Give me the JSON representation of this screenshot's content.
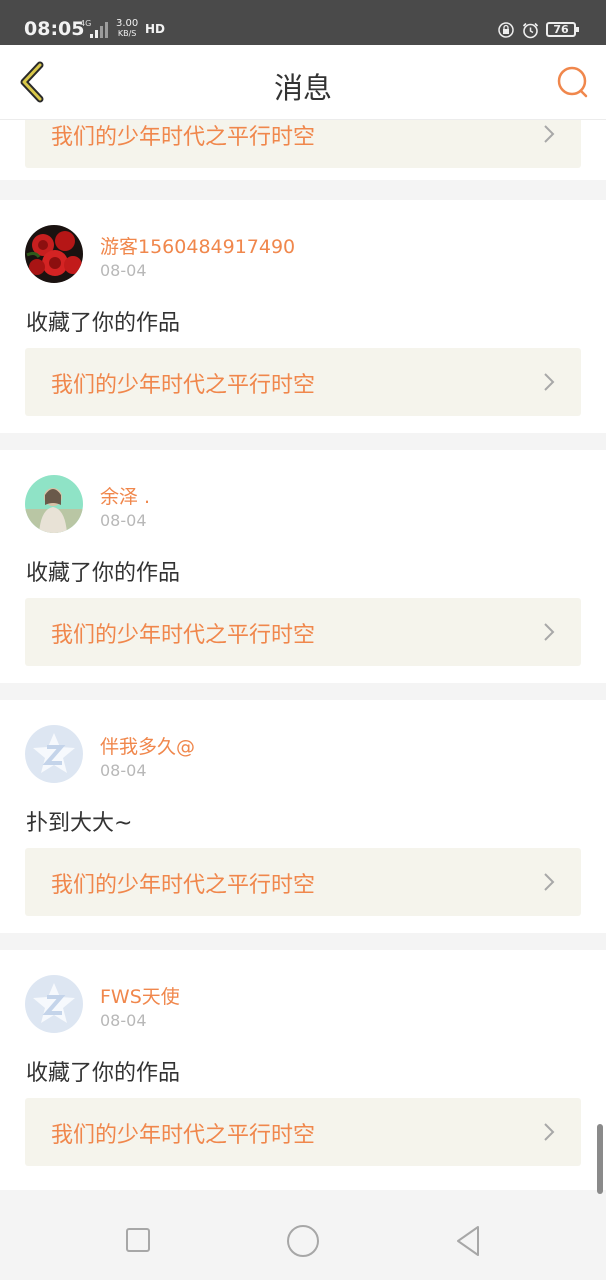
{
  "status_bar": {
    "time": "08:05",
    "network": "4G",
    "speed_value": "3.00",
    "speed_unit": "KB/S",
    "hd_label": "HD",
    "battery": "76"
  },
  "header": {
    "title": "消息",
    "back_icon": "chevron-left-icon",
    "search_icon": "search-icon"
  },
  "messages": [
    {
      "work_title": "我们的少年时代之平行时空"
    },
    {
      "username": "游客1560484917490",
      "time": "08-04",
      "text": "收藏了你的作品",
      "avatar": "red-roses-avatar",
      "work_title": "我们的少年时代之平行时空"
    },
    {
      "username": "余泽 .",
      "time": "08-04",
      "text": "收藏了你的作品",
      "avatar": "person-photo-avatar",
      "work_title": "我们的少年时代之平行时空"
    },
    {
      "username": "伴我多久@",
      "time": "08-04",
      "text": "扑到大大~",
      "avatar": "default-z-avatar",
      "work_title": "我们的少年时代之平行时空"
    },
    {
      "username": "FWS天使",
      "time": "08-04",
      "text": "收藏了你的作品",
      "avatar": "default-z-avatar",
      "work_title": "我们的少年时代之平行时空"
    }
  ],
  "colors": {
    "accent": "#f0874c",
    "work_bg": "#f5f4ec",
    "page_bg": "#f4f4f4",
    "status_bar_bg": "#4a4a4a"
  },
  "system_nav": {
    "recent_icon": "square-icon",
    "home_icon": "circle-icon",
    "back_icon": "triangle-back-icon"
  }
}
